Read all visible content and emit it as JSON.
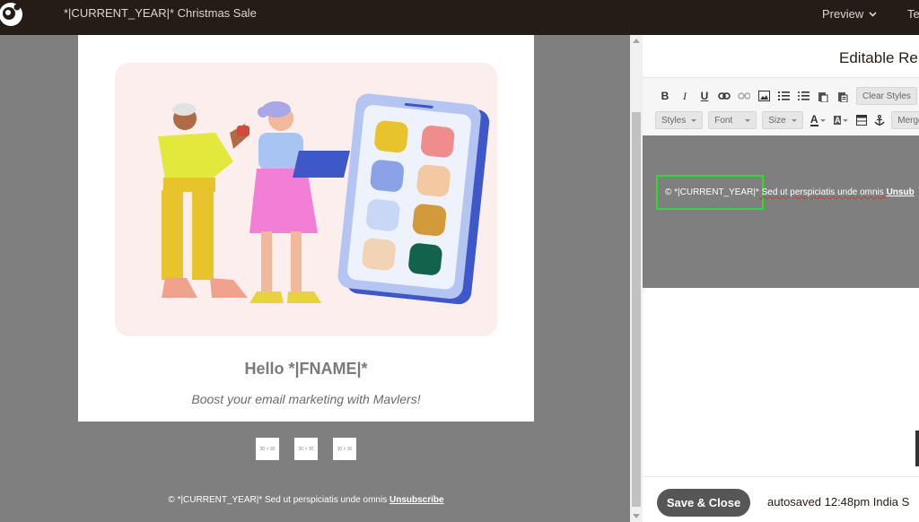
{
  "topbar": {
    "title": "*|CURRENT_YEAR|* Christmas Sale",
    "preview_label": "Preview",
    "te_label": "Te"
  },
  "email": {
    "hello": "Hello *|FNAME|*",
    "tagline": "Boost your email marketing with Mavlers!",
    "social_placeholders": [
      "30 × 30",
      "30 × 30",
      "30 × 30"
    ],
    "footer_prefix": "© *|CURRENT_YEAR|* Sed ut perspiciatis unde omnis ",
    "footer_link": "Unsubscribe"
  },
  "editor": {
    "title": "Editable Re",
    "toolbar": {
      "clear_styles": "Clear Styles",
      "styles": "Styles",
      "font": "Font",
      "size": "Size",
      "merge": "Merge"
    },
    "content": {
      "year_token": "© *|CURRENT_YEAR|*",
      "rest": " Sed ut perspiciatis unde omnis ",
      "unsub": "Unsub"
    },
    "save_close": "Save & Close",
    "autosaved": "autosaved 12:48pm India S"
  },
  "colors": {
    "topbar": "#241c15",
    "canvas": "#7f7f7f",
    "hero_bg": "#fdeeee",
    "highlight": "#2bdc2b",
    "save_button": "#565656"
  }
}
